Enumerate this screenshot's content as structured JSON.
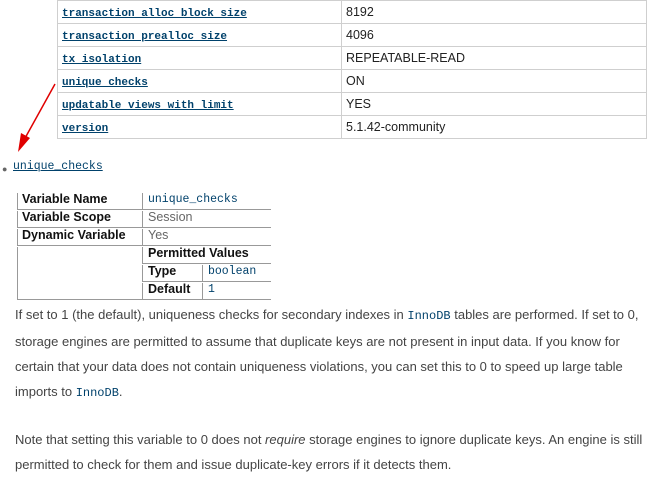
{
  "variables_table": [
    {
      "name": "transaction alloc block size",
      "value": "8192"
    },
    {
      "name": "transaction prealloc size",
      "value": "4096"
    },
    {
      "name": "tx isolation",
      "value": "REPEATABLE-READ"
    },
    {
      "name": "unique checks",
      "value": "ON"
    },
    {
      "name": "updatable views with limit",
      "value": "YES"
    },
    {
      "name": "version",
      "value": "5.1.42-community"
    }
  ],
  "section": {
    "heading": "unique_checks",
    "variable_name_label": "Variable Name",
    "variable_name_value": "unique_checks",
    "variable_scope_label": "Variable Scope",
    "variable_scope_value": "Session",
    "dynamic_variable_label": "Dynamic Variable",
    "dynamic_variable_value": "Yes",
    "permitted_values_label": "Permitted Values",
    "type_label": "Type",
    "type_value": "boolean",
    "default_label": "Default",
    "default_value": "1"
  },
  "paragraph1": {
    "part1": "If set to 1 (the default), uniqueness checks for secondary indexes in ",
    "code1": "InnoDB",
    "part2": " tables are performed. If set to 0, storage engines are permitted to assume that duplicate keys are not present in input data. If you know for certain that your data does not contain uniqueness violations, you can set this to 0 to speed up large table imports to ",
    "code2": "InnoDB",
    "part3": "."
  },
  "paragraph2": {
    "part1": "Note that setting this variable to 0 does not ",
    "emphasis": "require",
    "part2": " storage engines to ignore duplicate keys. An engine is still permitted to check for them and issue duplicate-key errors if it detects them."
  },
  "colors": {
    "link": "#00416b",
    "arrow": "#e00000"
  }
}
